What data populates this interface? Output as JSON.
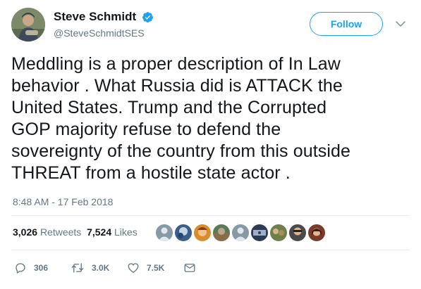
{
  "author": {
    "name": "Steve Schmidt",
    "handle": "@SteveSchmidtSES"
  },
  "follow_label": "Follow",
  "tweet_text": "Meddling is a proper description of In Law\nbehavior .  What Russia did is ATTACK the\nUnited States.  Trump and the Corrupted\nGOP majority refuse to defend the\nsovereignty of the country from this outside\nTHREAT from a hostile state actor .",
  "timestamp": "8:48 AM - 17 Feb 2018",
  "stats": {
    "retweets_count": "3,026",
    "retweets_label": "Retweets",
    "likes_count": "7,524",
    "likes_label": "Likes"
  },
  "actions": {
    "reply_count": "306",
    "retweet_count": "3.0K",
    "like_count": "7.5K"
  },
  "colors": {
    "accent": "#1da1f2",
    "text": "#14171a",
    "secondary": "#657786",
    "divider": "#e6ecf0"
  },
  "icons": [
    "avatar",
    "verified-badge-icon",
    "caret-down-icon",
    "reply-icon",
    "retweet-icon",
    "like-icon",
    "dm-icon"
  ]
}
